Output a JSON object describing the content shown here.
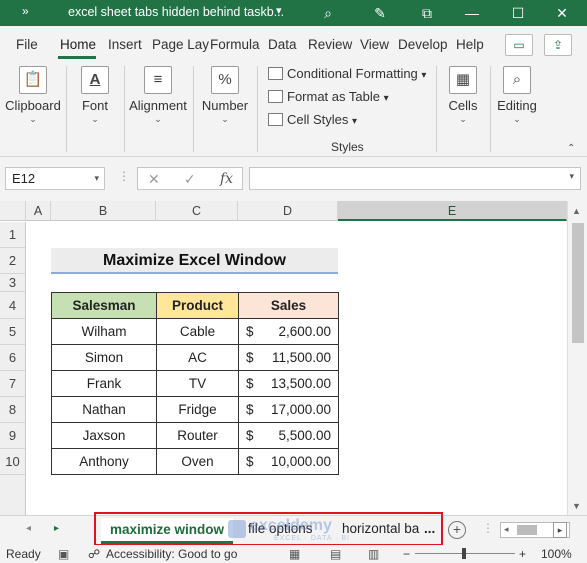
{
  "titlebar": {
    "expand": "»",
    "title": "excel sheet tabs hidden behind taskb...",
    "title_chevron": "▾",
    "icons": {
      "search": "⌕",
      "pen": "✎",
      "restore": "⧉",
      "minimize": "—",
      "maximize": "☐",
      "close": "✕"
    }
  },
  "menu": {
    "tabs": [
      "File",
      "Home",
      "Insert",
      "Page Lay",
      "Formula",
      "Data",
      "Review",
      "View",
      "Develop",
      "Help"
    ],
    "active": "Home",
    "comment_icon": "▭",
    "share_icon": "⇪"
  },
  "ribbon": {
    "clipboard": {
      "label": "Clipboard",
      "icon": "📋"
    },
    "font": {
      "label": "Font",
      "icon": "A"
    },
    "alignment": {
      "label": "Alignment",
      "icon": "≡"
    },
    "number": {
      "label": "Number",
      "icon": "%"
    },
    "styles": {
      "items": [
        "Conditional Formatting",
        "Format as Table",
        "Cell Styles"
      ],
      "chevron": "▾",
      "group_label": "Styles"
    },
    "cells": {
      "label": "Cells",
      "icon": "▦"
    },
    "editing": {
      "label": "Editing",
      "icon": "⌕"
    },
    "chevron": "⌄",
    "collapse": "⌃"
  },
  "formula_bar": {
    "name_box": "E12",
    "cancel": "✕",
    "enter": "✓",
    "fx": "fx",
    "formula": "",
    "dropdown": "▾"
  },
  "grid": {
    "columns": [
      "A",
      "B",
      "C",
      "D",
      "E"
    ],
    "selected_column": "E",
    "rows": [
      "1",
      "2",
      "3",
      "4",
      "5",
      "6",
      "7",
      "8",
      "9",
      "10"
    ],
    "title": "Maximize Excel Window",
    "headers": [
      "Salesman",
      "Product",
      "Sales"
    ],
    "records": [
      {
        "salesman": "Wilham",
        "product": "Cable",
        "currency": "$",
        "sales": "2,600.00"
      },
      {
        "salesman": "Simon",
        "product": "AC",
        "currency": "$",
        "sales": "11,500.00"
      },
      {
        "salesman": "Frank",
        "product": "TV",
        "currency": "$",
        "sales": "13,500.00"
      },
      {
        "salesman": "Nathan",
        "product": "Fridge",
        "currency": "$",
        "sales": "17,000.00"
      },
      {
        "salesman": "Jaxson",
        "product": "Router",
        "currency": "$",
        "sales": "5,500.00"
      },
      {
        "salesman": "Anthony",
        "product": "Oven",
        "currency": "$",
        "sales": "10,000.00"
      }
    ]
  },
  "sheet_tabs": {
    "prev": "◂",
    "next": "▸",
    "tabs": [
      "maximize window",
      "file options",
      "horizontal ba"
    ],
    "active": "maximize window",
    "more": "...",
    "add": "+",
    "highlight_color": "#e0141c"
  },
  "watermark": {
    "name": "exceldemy",
    "tagline": "EXCEL · DATA · BI"
  },
  "status": {
    "ready": "Ready",
    "accessibility": "Accessibility: Good to go",
    "zoom_minus": "−",
    "zoom_plus": "+",
    "zoom": "100%"
  },
  "colors": {
    "accent": "#217346",
    "salesman_header": "#c6e0b4",
    "product_header": "#ffe699",
    "sales_header": "#fce4d6"
  }
}
